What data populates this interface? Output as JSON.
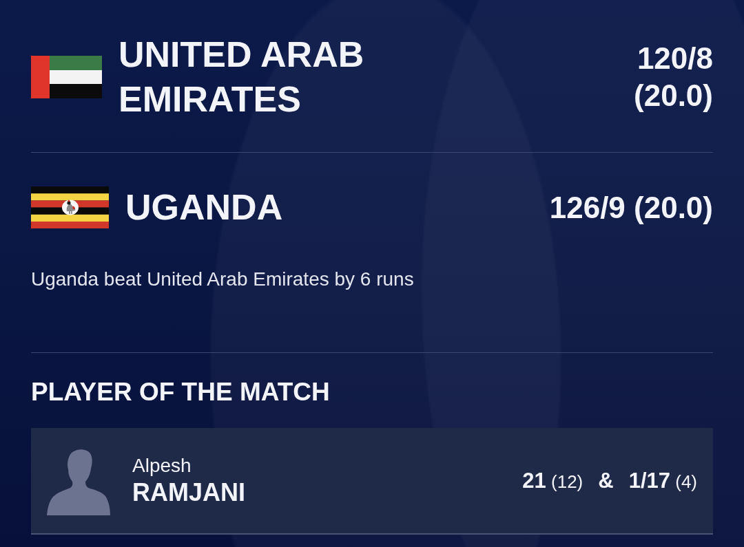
{
  "teams": [
    {
      "name": "UNITED ARAB EMIRATES",
      "score": "120/8 (20.0)"
    },
    {
      "name": "UGANDA",
      "score": "126/9 (20.0)"
    }
  ],
  "result": "Uganda beat United Arab Emirates by 6 runs",
  "player_of_the_match": {
    "heading": "PLAYER OF THE MATCH",
    "first_name": "Alpesh",
    "last_name": "RAMJANI",
    "batting": "**21** (12)",
    "separator": "&",
    "bowling": "**1/17** (4)"
  }
}
